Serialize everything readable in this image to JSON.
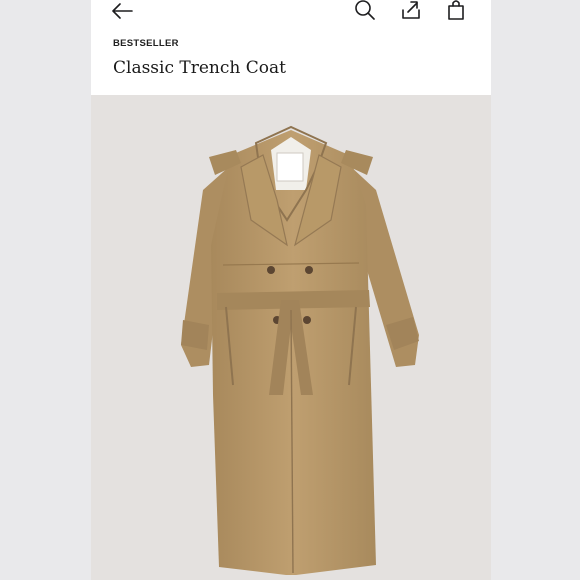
{
  "header": {
    "back_icon": "arrow-left-icon",
    "search_icon": "search-icon",
    "share_icon": "share-icon",
    "bag_icon": "shopping-bag-icon"
  },
  "product": {
    "badge": "BESTSELLER",
    "name": "Classic Trench Coat",
    "image_alt": "Classic Trench Coat product photo",
    "color": "#b9996a"
  },
  "colors": {
    "background": "#ffffff",
    "page_margin": "#e9e9eb",
    "photo_bg": "#e4e1df"
  }
}
